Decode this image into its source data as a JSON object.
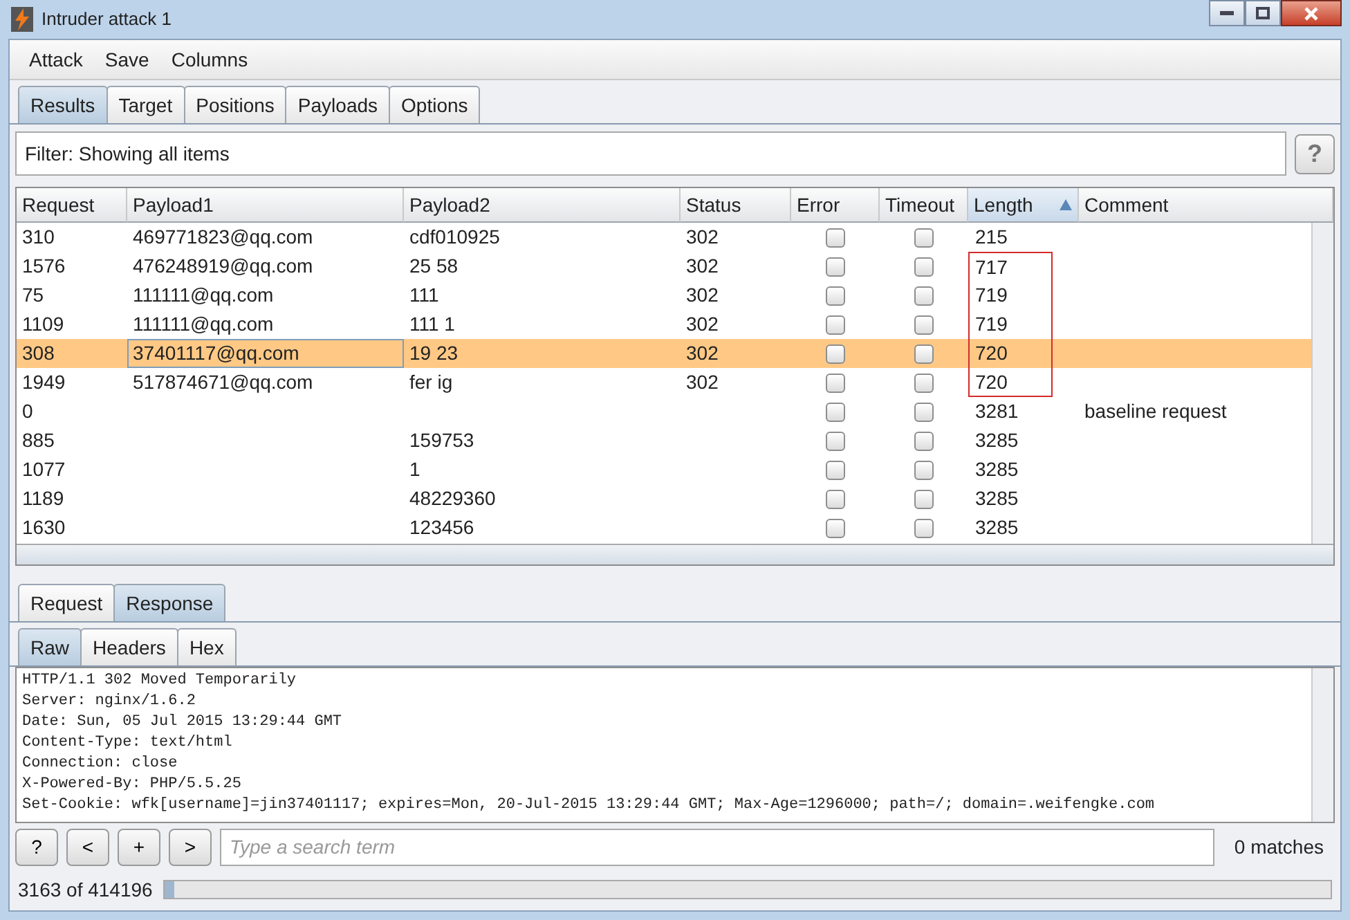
{
  "window": {
    "title": "Intruder attack 1"
  },
  "menu": [
    "Attack",
    "Save",
    "Columns"
  ],
  "tabs": [
    {
      "label": "Results",
      "selected": true
    },
    {
      "label": "Target",
      "selected": false
    },
    {
      "label": "Positions",
      "selected": false
    },
    {
      "label": "Payloads",
      "selected": false
    },
    {
      "label": "Options",
      "selected": false
    }
  ],
  "filter": {
    "label": "Filter: Showing all items",
    "help": "?"
  },
  "table": {
    "columns": [
      {
        "label": "Request",
        "sorted": false
      },
      {
        "label": "Payload1",
        "sorted": false
      },
      {
        "label": "Payload2",
        "sorted": false
      },
      {
        "label": "Status",
        "sorted": false
      },
      {
        "label": "Error",
        "sorted": false
      },
      {
        "label": "Timeout",
        "sorted": false
      },
      {
        "label": "Length",
        "sorted": true
      },
      {
        "label": "Comment",
        "sorted": false
      }
    ],
    "rows": [
      {
        "request": "310",
        "payload1": "469771823@qq.com",
        "payload2": "cdf010925",
        "status": "302",
        "error": false,
        "timeout": false,
        "length": "215",
        "comment": "",
        "selected": false,
        "flagged": false
      },
      {
        "request": "1576",
        "payload1": "476248919@qq.com",
        "payload2": "25 58",
        "status": "302",
        "error": false,
        "timeout": false,
        "length": "717",
        "comment": "",
        "selected": false,
        "flagged": true
      },
      {
        "request": "75",
        "payload1": "111111@qq.com",
        "payload2": "111",
        "status": "302",
        "error": false,
        "timeout": false,
        "length": "719",
        "comment": "",
        "selected": false,
        "flagged": true
      },
      {
        "request": "1109",
        "payload1": "111111@qq.com",
        "payload2": "111 1",
        "status": "302",
        "error": false,
        "timeout": false,
        "length": "719",
        "comment": "",
        "selected": false,
        "flagged": true
      },
      {
        "request": "308",
        "payload1": "37401117@qq.com",
        "payload2": "19 23",
        "status": "302",
        "error": false,
        "timeout": false,
        "length": "720",
        "comment": "",
        "selected": true,
        "flagged": true
      },
      {
        "request": "1949",
        "payload1": "517874671@qq.com",
        "payload2": "fer ig",
        "status": "302",
        "error": false,
        "timeout": false,
        "length": "720",
        "comment": "",
        "selected": false,
        "flagged": true
      },
      {
        "request": "0",
        "payload1": "",
        "payload2": "",
        "status": "",
        "error": false,
        "timeout": false,
        "length": "3281",
        "comment": "baseline request",
        "selected": false,
        "flagged": false
      },
      {
        "request": "885",
        "payload1": "",
        "payload2": "159753",
        "status": "",
        "error": false,
        "timeout": false,
        "length": "3285",
        "comment": "",
        "selected": false,
        "flagged": false
      },
      {
        "request": "1077",
        "payload1": "",
        "payload2": "1",
        "status": "",
        "error": false,
        "timeout": false,
        "length": "3285",
        "comment": "",
        "selected": false,
        "flagged": false
      },
      {
        "request": "1189",
        "payload1": "",
        "payload2": "48229360",
        "status": "",
        "error": false,
        "timeout": false,
        "length": "3285",
        "comment": "",
        "selected": false,
        "flagged": false
      },
      {
        "request": "1630",
        "payload1": "",
        "payload2": "123456",
        "status": "",
        "error": false,
        "timeout": false,
        "length": "3285",
        "comment": "",
        "selected": false,
        "flagged": false
      }
    ]
  },
  "message_tabs": [
    {
      "label": "Request",
      "selected": false
    },
    {
      "label": "Response",
      "selected": true
    }
  ],
  "view_tabs": [
    {
      "label": "Raw",
      "selected": true
    },
    {
      "label": "Headers",
      "selected": false
    },
    {
      "label": "Hex",
      "selected": false
    }
  ],
  "response_lines": [
    "HTTP/1.1 302 Moved Temporarily",
    "Server: nginx/1.6.2",
    "Date: Sun, 05 Jul 2015 13:29:44 GMT",
    "Content-Type: text/html",
    "Connection: close",
    "X-Powered-By: PHP/5.5.25",
    "Set-Cookie: wfk[username]=jin37401117; expires=Mon, 20-Jul-2015 13:29:44 GMT; Max-Age=1296000; path=/; domain=.weifengke.com"
  ],
  "search": {
    "buttons": [
      "?",
      "<",
      "+",
      ">"
    ],
    "placeholder": "Type a search term",
    "matches": "0 matches"
  },
  "status_bar": {
    "progress": "3163 of 414196",
    "level": 0.008
  }
}
